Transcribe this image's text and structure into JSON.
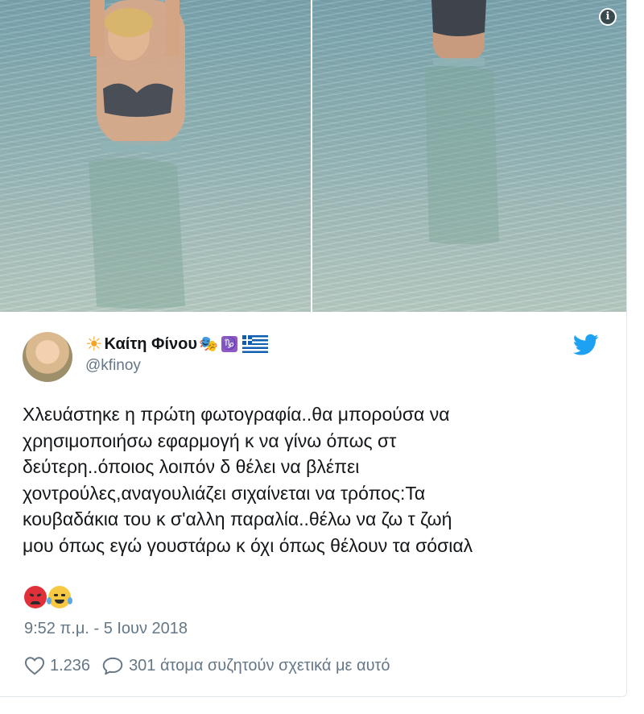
{
  "media": {
    "photos": [
      "photo-left",
      "photo-right"
    ],
    "info_icon": "i"
  },
  "author": {
    "display_name": "Καίτη Φίνου",
    "handle": "@kfinoy",
    "name_emojis": [
      "sun-icon",
      "performing-arts-icon",
      "capricorn-icon",
      "greece-flag-icon"
    ],
    "capricorn_glyph": "♑"
  },
  "tweet": {
    "text": "Χλευάστηκε η πρώτη φωτογραφία..θα μπορούσα να\nχρησιμοποιήσω εφαρμογή κ να γίνω όπως στ\nδεύτερη..όποιος λοιπόν δ θέλει να βλέπει\nχοντρούλες,αναγουλιάζει σιχαίνεται να τρόπος:Τα\nκουβαδάκια του κ σ'αλλη παραλία..θέλω να ζω τ ζωή\nμου όπως εγώ γουστάρω κ όχι όπως θέλουν τα σόσιαλ",
    "trailing_emojis": [
      "angry-face-icon",
      "tears-of-joy-icon"
    ],
    "timestamp": "9:52 π.μ. - 5 Ιουν 2018"
  },
  "actions": {
    "likes": "1.236",
    "replies_text": "301 άτομα συζητούν σχετικά με αυτό"
  },
  "colors": {
    "twitter_blue": "#1da1f2",
    "muted": "#657786",
    "text": "#14171a"
  }
}
